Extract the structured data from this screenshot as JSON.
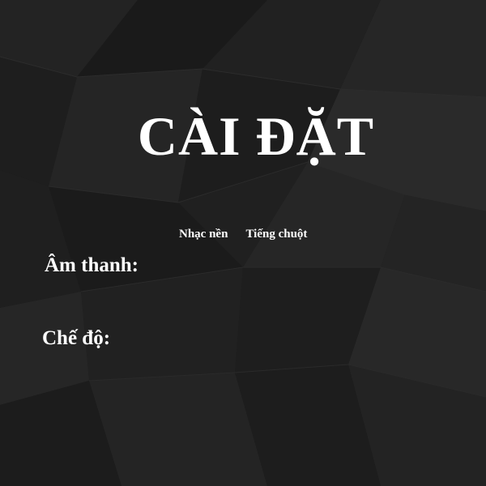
{
  "settings": {
    "title": "CÀI ĐẶT",
    "sound_options": [
      "Nhạc nền",
      "Tiếng chuột"
    ],
    "sound_label": "Âm thanh:",
    "mode_label": "Chế độ:"
  },
  "colors": {
    "background": "#1b1b1b",
    "text": "#ffffff"
  }
}
